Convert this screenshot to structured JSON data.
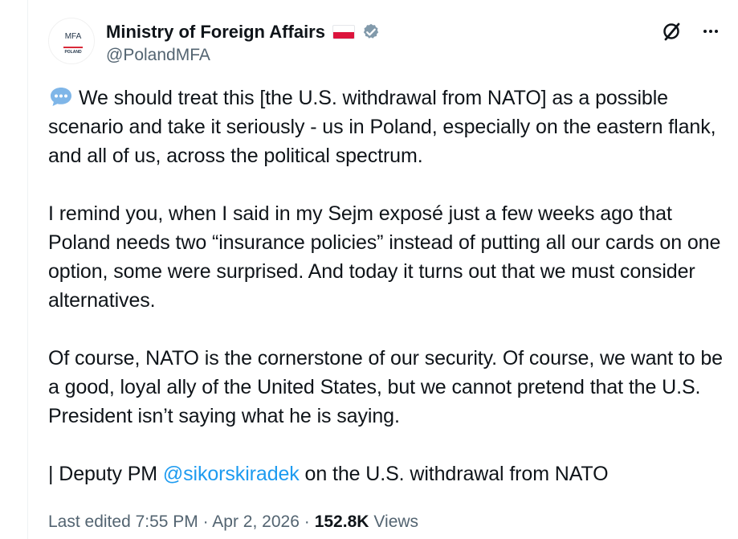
{
  "post": {
    "author": {
      "avatar_logo_text": "MFA",
      "avatar_logo_subtext": "POLAND",
      "display_name": "Ministry of Foreign Affairs",
      "handle": "@PolandMFA",
      "flag_icon": "poland-flag-icon",
      "verified_icon": "verified-badge-icon",
      "verified_color": "#829aab"
    },
    "actions": {
      "grok_icon": "grok-icon",
      "more_icon": "more-options-icon"
    },
    "body": {
      "speech_icon": "speech-bubble-icon",
      "paragraph_1": "We should treat this [the U.S. withdrawal from NATO] as a possible scenario and take it seriously - us in Poland, especially on the eastern flank, and all of us, across the political spectrum.",
      "paragraph_2": "I remind you, when I said in my Sejm exposé just a few weeks ago that Poland needs two “insurance policies” instead of putting all our cards on one option, some were surprised. And today it turns out that we must consider alternatives.",
      "paragraph_3": "Of course, NATO is the cornerstone of our security. Of course, we want to be a good, loyal ally of the United States, but we cannot pretend that the U.S. President isn’t saying what he is saying.",
      "paragraph_4_prefix": "| Deputy PM ",
      "paragraph_4_mention": "@sikorskiradek",
      "paragraph_4_suffix": " on the U.S. withdrawal from NATO"
    },
    "meta": {
      "edited_label": "Last edited 7:55 PM · Apr 2, 2026 ·",
      "views_count": "152.8K",
      "views_label": "Views"
    },
    "colors": {
      "link": "#1d9bf0",
      "text": "#0f1419",
      "secondary_text": "#536471",
      "speech_bubble": "#7fb6e8"
    }
  }
}
